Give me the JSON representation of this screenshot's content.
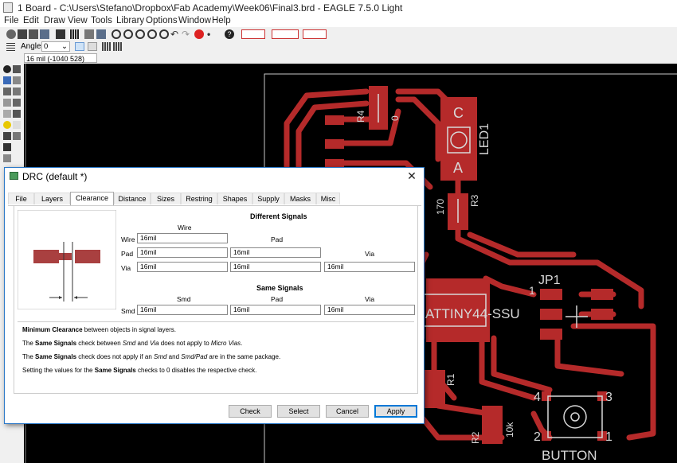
{
  "window": {
    "title": "1 Board - C:\\Users\\Stefano\\Dropbox\\Fab Academy\\Week06\\Final3.brd - EAGLE 7.5.0 Light"
  },
  "menu": [
    "File",
    "Edit",
    "Draw",
    "View",
    "Tools",
    "Library",
    "Options",
    "Window",
    "Help"
  ],
  "parameters": {
    "angle_label": "Angle:",
    "angle_value": "0"
  },
  "coordinates": "16 mil (-1040 528)",
  "board": {
    "labels": {
      "led_c": "C",
      "led_a": "A",
      "led_name": "LED1",
      "r4": "R4",
      "r4_val": "0",
      "r3": "R3",
      "r3_val": "170",
      "jp1": "JP1",
      "jp1_pin": "1",
      "ic": "ATTINY44-SSU",
      "r1": "R1",
      "r2": "R2",
      "r2_val": "10k",
      "btn_4": "4",
      "btn_3": "3",
      "btn_2": "2",
      "btn_1": "1",
      "button": "BUTTON"
    }
  },
  "drc": {
    "title": "DRC (default *)",
    "close": "✕",
    "tabs": [
      "File",
      "Layers",
      "Clearance",
      "Distance",
      "Sizes",
      "Restring",
      "Shapes",
      "Supply",
      "Masks",
      "Misc"
    ],
    "active_tab": "Clearance",
    "different_signals": {
      "heading": "Different Signals",
      "col_wire": "Wire",
      "col_pad": "Pad",
      "col_via": "Via",
      "row_wire": "Wire",
      "row_pad": "Pad",
      "row_via": "Via",
      "wire_wire": "16mil",
      "pad_wire": "16mil",
      "pad_pad": "16mil",
      "via_wire": "16mil",
      "via_pad": "16mil",
      "via_via": "16mil"
    },
    "same_signals": {
      "heading": "Same Signals",
      "col_smd": "Smd",
      "col_pad": "Pad",
      "col_via": "Via",
      "row_smd": "Smd",
      "smd_smd": "16mil",
      "smd_pad": "16mil",
      "smd_via": "16mil"
    },
    "notes": {
      "n1_bold": "Minimum Clearance",
      "n1_rest": " between objects in signal layers.",
      "n2_a": "The ",
      "n2_bold": "Same Signals",
      "n2_b": " check between ",
      "n2_smd": "Smd",
      "n2_c": " and ",
      "n2_via": "Via",
      "n2_d": " does not apply to ",
      "n2_micro": "Micro Vias",
      "n2_e": ".",
      "n3_a": "The ",
      "n3_bold": "Same Signals",
      "n3_b": " check does not apply if an ",
      "n3_smd": "Smd",
      "n3_c": " and ",
      "n3_smdpad": "Smd/Pad",
      "n3_d": " are in the same package.",
      "n4_a": "Setting the values for the ",
      "n4_bold": "Same Signals",
      "n4_b": " checks to 0 disables the respective check."
    },
    "buttons": {
      "check": "Check",
      "select": "Select",
      "cancel": "Cancel",
      "apply": "Apply"
    }
  },
  "colors": {
    "copper": "#b52a2a",
    "board_bg": "#000000",
    "silkscreen": "#d8d8d8",
    "accent": "#0078d7"
  }
}
